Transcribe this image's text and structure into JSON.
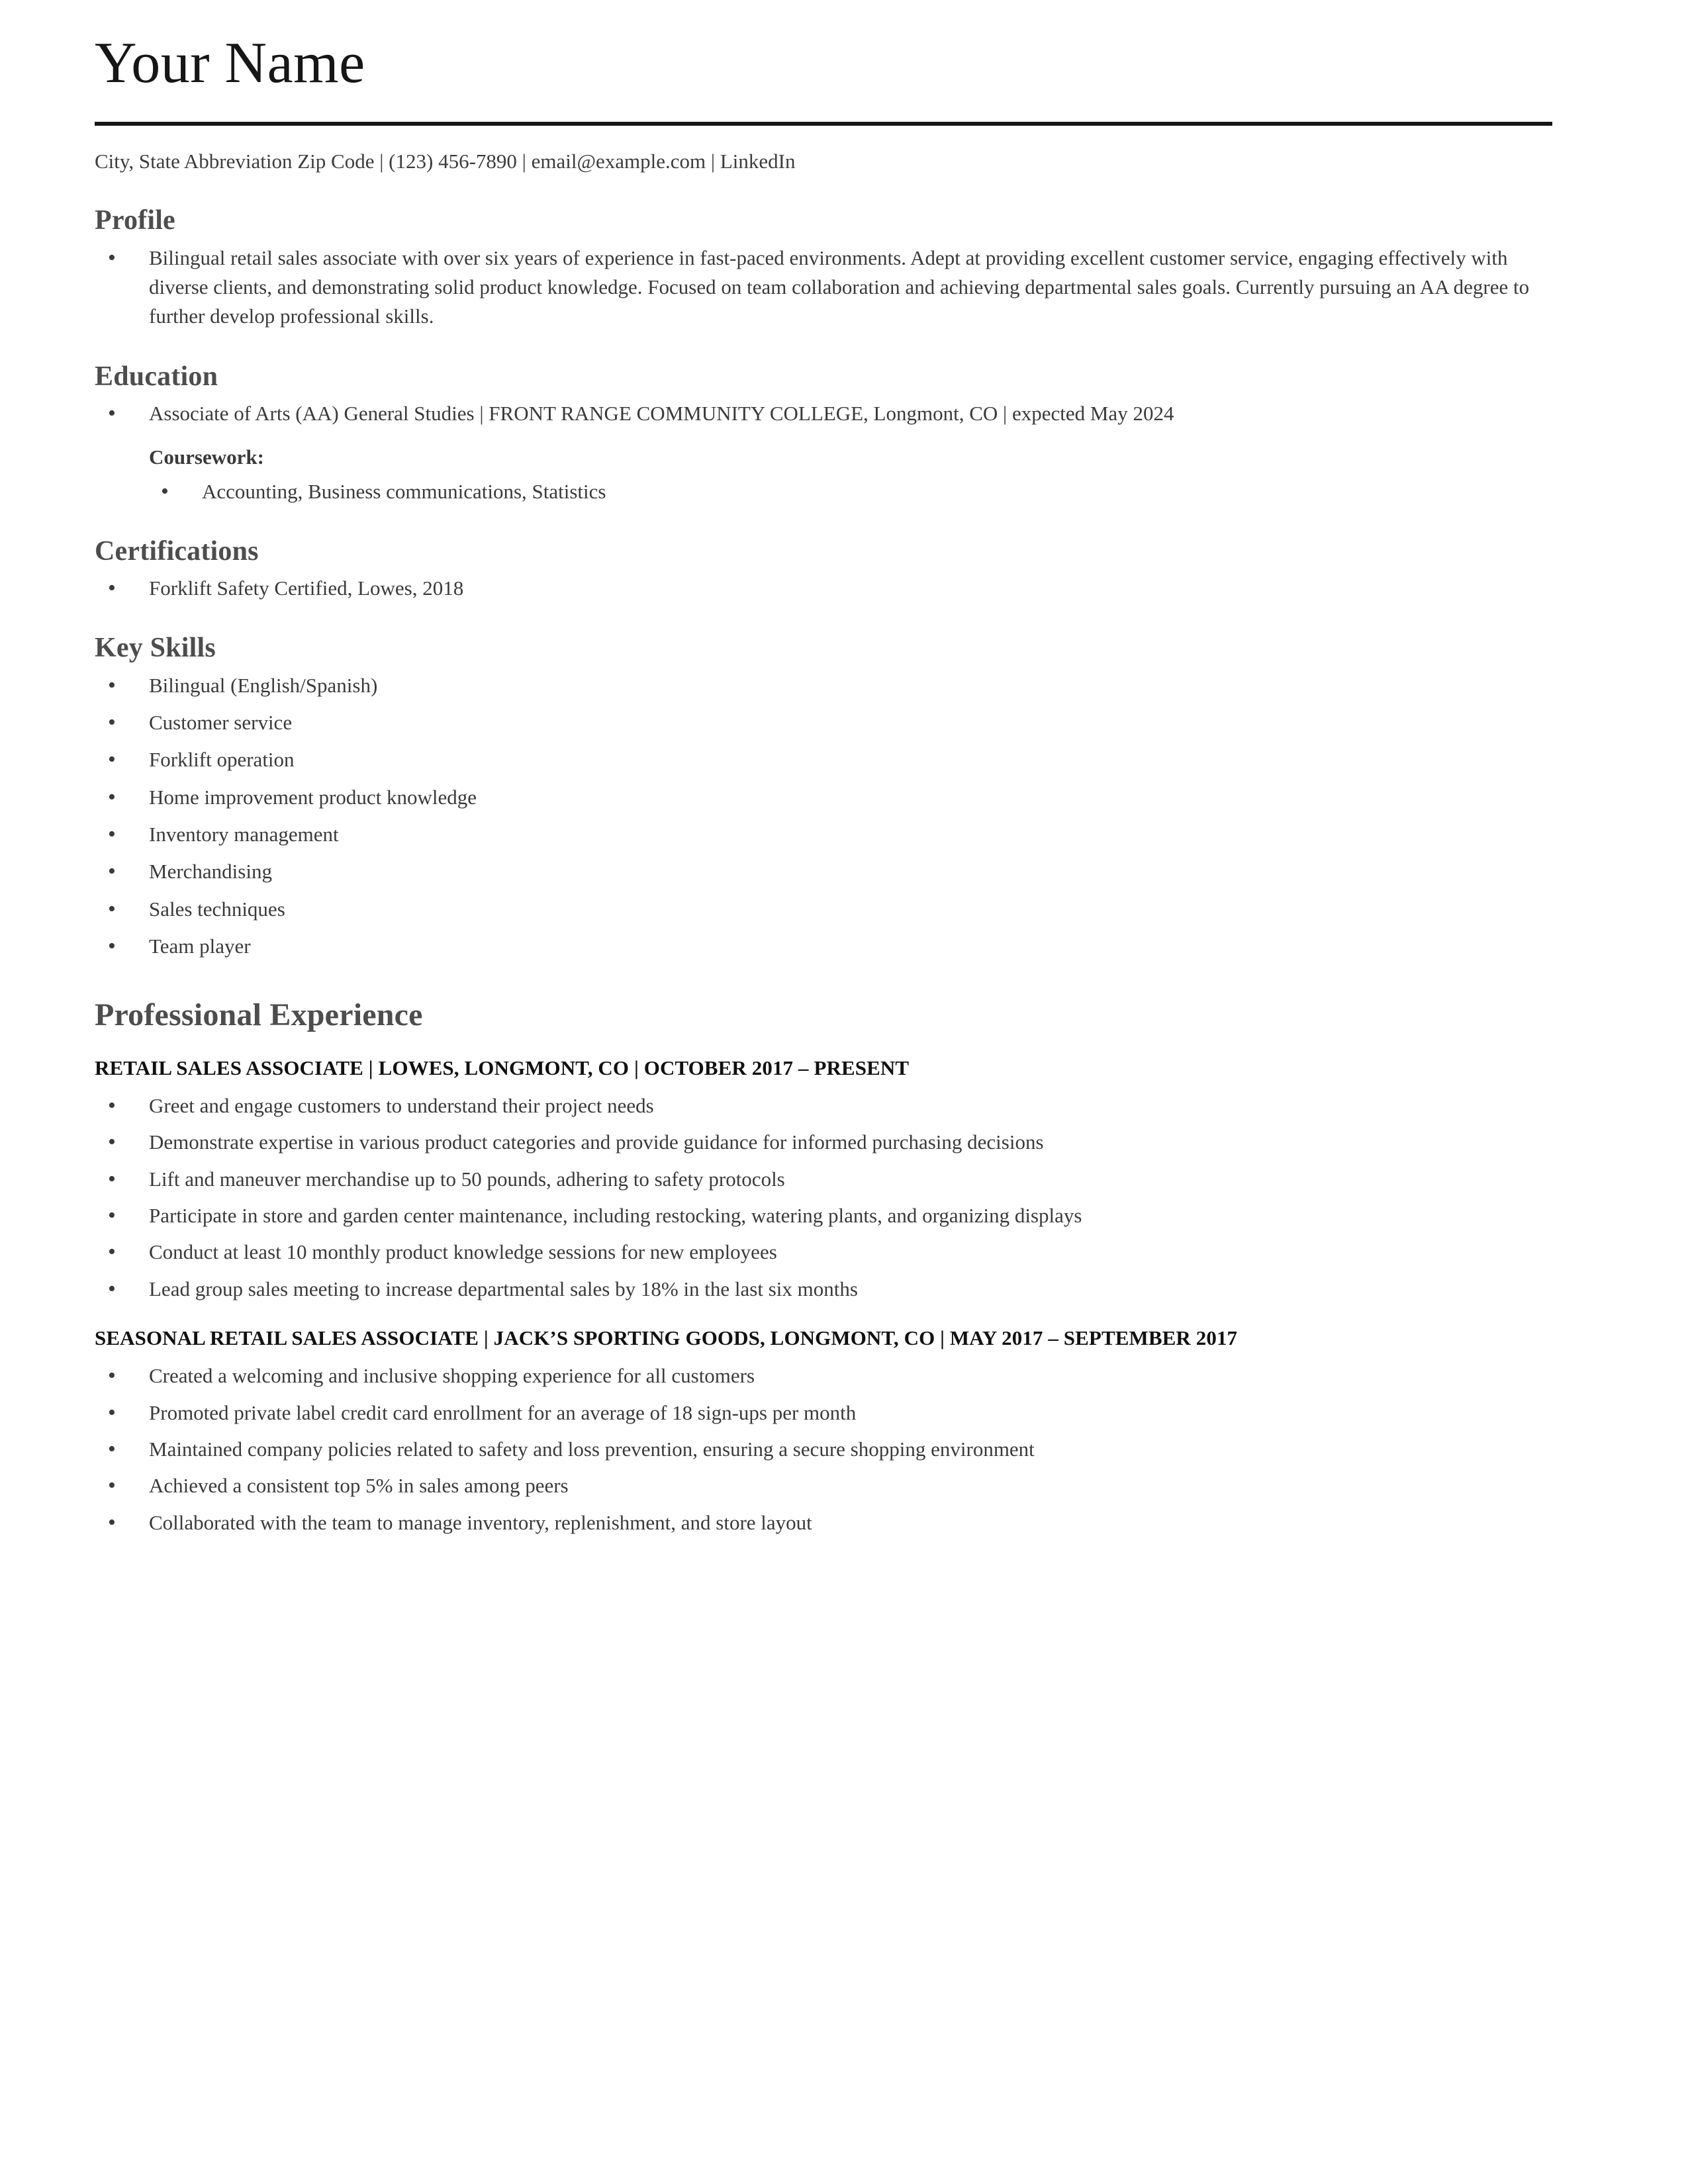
{
  "header": {
    "name": "Your Name",
    "contact": "City, State Abbreviation Zip Code | (123) 456-7890 | email@example.com | LinkedIn"
  },
  "profile": {
    "title": "Profile",
    "items": [
      "Bilingual retail sales associate with over six years of experience in fast-paced environments. Adept at providing excellent customer service, engaging effectively with diverse clients, and demonstrating solid product knowledge. Focused on team collaboration and achieving departmental sales goals. Currently pursuing an AA degree to further develop professional skills."
    ]
  },
  "education": {
    "title": "Education",
    "items": [
      "Associate of Arts (AA) General Studies | FRONT RANGE COMMUNITY COLLEGE, Longmont, CO | expected May 2024"
    ],
    "coursework_label": "Coursework:",
    "coursework_items": [
      "Accounting, Business communications, Statistics"
    ]
  },
  "certifications": {
    "title": "Certifications",
    "items": [
      "Forklift Safety Certified, Lowes, 2018"
    ]
  },
  "key_skills": {
    "title": "Key Skills",
    "items": [
      "Bilingual (English/Spanish)",
      "Customer service",
      "Forklift operation",
      "Home improvement product knowledge",
      "Inventory management",
      "Merchandising",
      "Sales techniques",
      "Team player"
    ]
  },
  "experience": {
    "title": "Professional Experience",
    "jobs": [
      {
        "heading": "RETAIL SALES ASSOCIATE | LOWES, LONGMONT, CO | OCTOBER 2017 – PRESENT",
        "bullets": [
          "Greet and engage customers to understand their project needs",
          "Demonstrate expertise in various product categories and provide guidance for informed purchasing decisions",
          "Lift and maneuver merchandise up to 50 pounds, adhering to safety protocols",
          "Participate in store and garden center maintenance, including restocking, watering plants, and organizing displays",
          "Conduct at least 10 monthly product knowledge sessions for new employees",
          "Lead group sales meeting to increase departmental sales by 18% in the last six months"
        ]
      },
      {
        "heading": "SEASONAL RETAIL SALES ASSOCIATE | JACK’S SPORTING GOODS, LONGMONT, CO | MAY 2017 – SEPTEMBER 2017",
        "bullets": [
          "Created a welcoming and inclusive shopping experience for all customers",
          "Promoted private label credit card enrollment for an average of 18 sign-ups per month",
          "Maintained company policies related to safety and loss prevention, ensuring a secure shopping environment",
          "Achieved a consistent top 5% in sales among peers",
          "Collaborated with the team to manage inventory, replenishment, and store layout"
        ]
      }
    ]
  }
}
